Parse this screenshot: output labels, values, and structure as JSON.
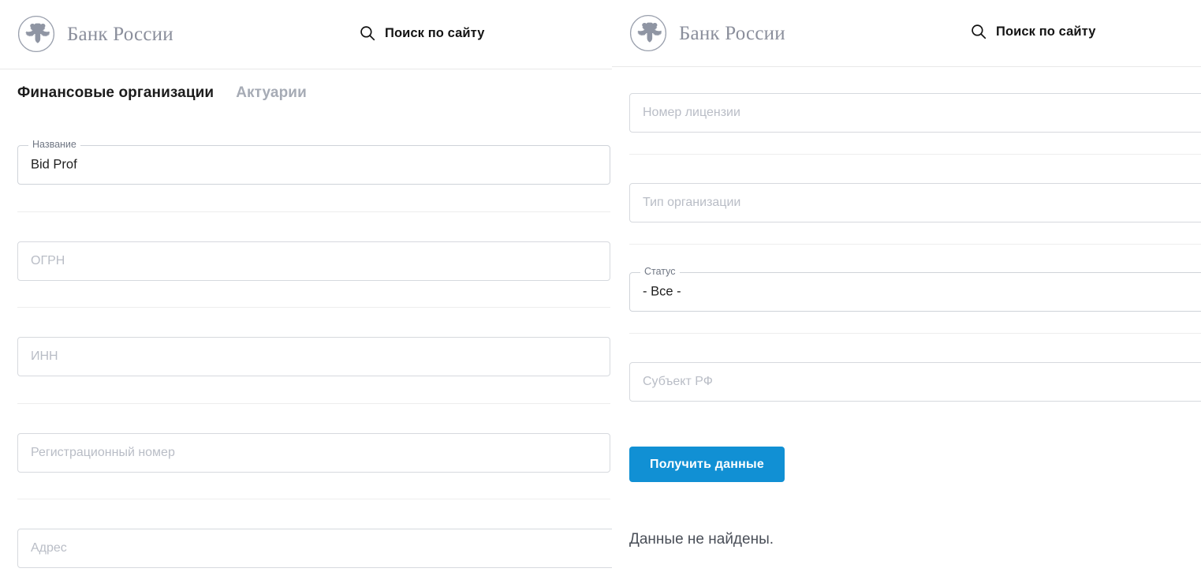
{
  "header": {
    "logo_icon": "bank-of-russia-eagle-logo",
    "brand_name": "Банк России",
    "search_icon": "search-icon",
    "search_label": "Поиск по сайту"
  },
  "tabs": [
    {
      "label": "Финансовые организации",
      "active": true
    },
    {
      "label": "Актуарии",
      "active": false
    }
  ],
  "form": {
    "left_column": [
      {
        "name": "name",
        "label": "Название",
        "value": "Bid Prof",
        "placeholder": "",
        "state": "filled"
      },
      {
        "name": "ogrn",
        "label": "",
        "value": "",
        "placeholder": "ОГРН",
        "state": "empty"
      },
      {
        "name": "inn",
        "label": "",
        "value": "",
        "placeholder": "ИНН",
        "state": "empty"
      },
      {
        "name": "registration_number",
        "label": "",
        "value": "",
        "placeholder": "Регистрационный номер",
        "state": "empty"
      },
      {
        "name": "address",
        "label": "",
        "value": "",
        "placeholder": "Адрес",
        "state": "empty"
      }
    ],
    "right_column": [
      {
        "name": "license_number",
        "label": "",
        "value": "",
        "placeholder": "Номер лицензии",
        "state": "empty"
      },
      {
        "name": "organization_type",
        "label": "",
        "value": "",
        "placeholder": "Тип организации",
        "state": "empty"
      },
      {
        "name": "status",
        "label": "Статус",
        "value": "- Все -",
        "placeholder": "",
        "state": "filled"
      },
      {
        "name": "subject_rf",
        "label": "",
        "value": "",
        "placeholder": "Субъект РФ",
        "state": "empty"
      }
    ],
    "submit_label": "Получить данные"
  },
  "results": {
    "empty_message": "Данные не найдены."
  },
  "colors": {
    "accent_blue": "#1190d4",
    "brand_grey": "#8b8f9c",
    "placeholder_grey": "#b9bdc6",
    "tab_inactive": "#a6abb5",
    "border_grey": "#d6d9de"
  }
}
